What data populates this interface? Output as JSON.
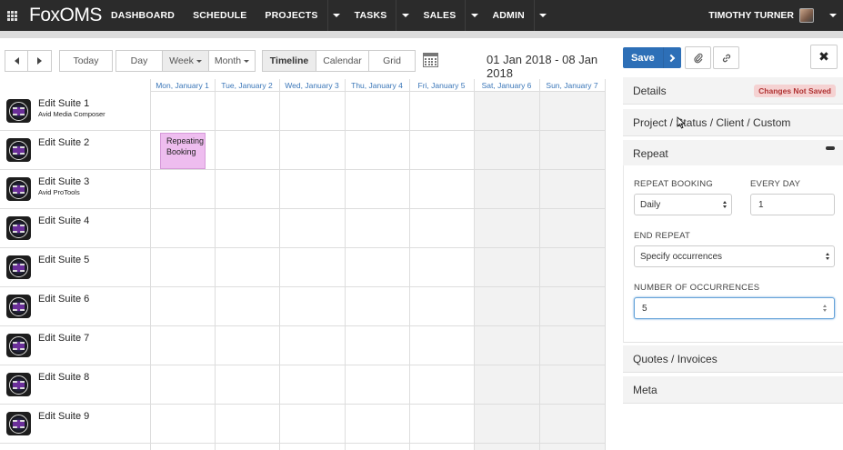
{
  "nav": {
    "logo": "FoxOMS",
    "items": [
      {
        "label": "DASHBOARD",
        "has_menu": false
      },
      {
        "label": "SCHEDULE",
        "has_menu": false
      },
      {
        "label": "PROJECTS",
        "has_menu": true
      },
      {
        "label": "TASKS",
        "has_menu": true
      },
      {
        "label": "SALES",
        "has_menu": true
      },
      {
        "label": "ADMIN",
        "has_menu": true
      }
    ],
    "user_name": "TIMOTHY TURNER"
  },
  "toolbar": {
    "today": "Today",
    "day": "Day",
    "week": "Week",
    "month": "Month",
    "timeline": "Timeline",
    "calendar": "Calendar",
    "grid": "Grid",
    "date_range": "01 Jan 2018 - 08 Jan 2018",
    "save": "Save",
    "close": "✖"
  },
  "calendar": {
    "days": [
      "Mon, January 1",
      "Tue, January 2",
      "Wed, January 3",
      "Thu, January 4",
      "Fri, January 5",
      "Sat, January 6",
      "Sun, January 7"
    ],
    "resources": [
      {
        "name": "Edit Suite 1",
        "sub": "Avid Media Composer"
      },
      {
        "name": "Edit Suite 2",
        "sub": ""
      },
      {
        "name": "Edit Suite 3",
        "sub": "Avid ProTools"
      },
      {
        "name": "Edit Suite 4",
        "sub": ""
      },
      {
        "name": "Edit Suite 5",
        "sub": ""
      },
      {
        "name": "Edit Suite 6",
        "sub": ""
      },
      {
        "name": "Edit Suite 7",
        "sub": ""
      },
      {
        "name": "Edit Suite 8",
        "sub": ""
      },
      {
        "name": "Edit Suite 9",
        "sub": ""
      }
    ],
    "booking": {
      "label": "Repeating Booking",
      "color": "#eebdef"
    }
  },
  "panel": {
    "details": "Details",
    "status_badge": "Changes Not Saved",
    "project": "Project / Status / Client / Custom",
    "repeat": "Repeat",
    "repeat_booking_label": "REPEAT BOOKING",
    "repeat_booking_value": "Daily",
    "every_label": "EVERY DAY",
    "every_value": "1",
    "end_repeat_label": "END REPEAT",
    "end_repeat_value": "Specify occurrences",
    "occurrences_label": "NUMBER OF OCCURRENCES",
    "occurrences_value": "5",
    "quotes": "Quotes / Invoices",
    "meta": "Meta"
  },
  "colors": {
    "navbar": "#2b2b2b",
    "accent": "#2d6fb7",
    "badge_bg": "#f5d2d2",
    "badge_text": "#b03333",
    "day_header": "#3a76b8"
  },
  "icons": {
    "apps": "grid-icon",
    "prev": "chevron-left-icon",
    "next": "chevron-right-icon",
    "date_picker": "calendar-icon",
    "attach": "paperclip-icon",
    "link": "link-icon",
    "close": "close-icon",
    "resource": "avid-icon"
  }
}
